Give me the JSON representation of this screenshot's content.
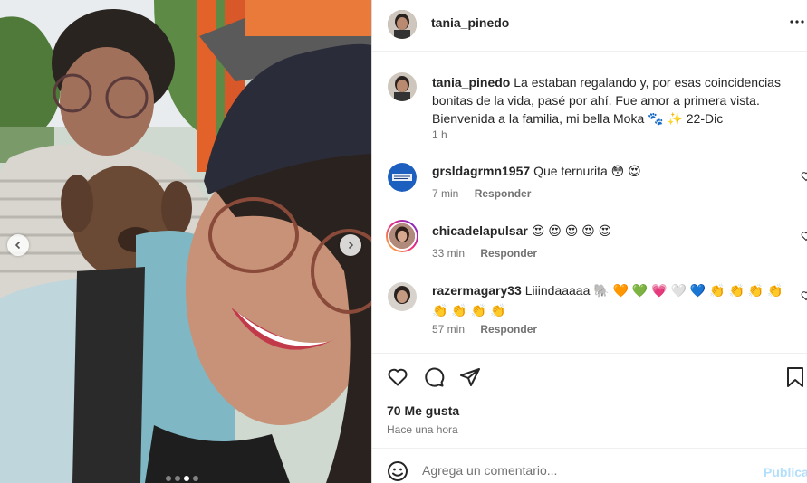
{
  "post": {
    "author": "tania_pinedo",
    "caption": "La estaban regalando y, por esas coincidencias bonitas de la vida, pasé por ahí. Fue amor a primera vista. Bienvenida a la familia, mi bella Moka 🐾 ✨ 22-Dic",
    "caption_time": "1 h"
  },
  "comments": [
    {
      "user": "grsldagrmn1957",
      "text": "Que ternurita 😳 😍",
      "time": "7 min",
      "reply": "Responder"
    },
    {
      "user": "chicadelapulsar",
      "text": "😍 😍 😍 😍 😍",
      "time": "33 min",
      "reply": "Responder"
    },
    {
      "user": "razermagary33",
      "text": "Liiindaaaaa 🐘 🧡 💚 💗 🤍 💙  👏 👏 👏 👏 👏 👏 👏 👏",
      "time": "57 min",
      "reply": "Responder"
    }
  ],
  "footer": {
    "likes": "70 Me gusta",
    "posted": "Hace una hora",
    "comment_placeholder": "Agrega un comentario...",
    "publish": "Publicar"
  },
  "carousel": {
    "total": 4,
    "active_index": 2
  },
  "icons": {
    "more": "more-options-icon",
    "like": "heart-icon",
    "comment": "comment-icon",
    "share": "share-icon",
    "save": "bookmark-icon",
    "emoji": "emoji-icon",
    "prev": "chevron-left-icon",
    "next": "chevron-right-icon"
  },
  "colors": {
    "story_ring": "#d6249f",
    "publish_disabled": "#b2dffc",
    "meta": "#737373"
  }
}
